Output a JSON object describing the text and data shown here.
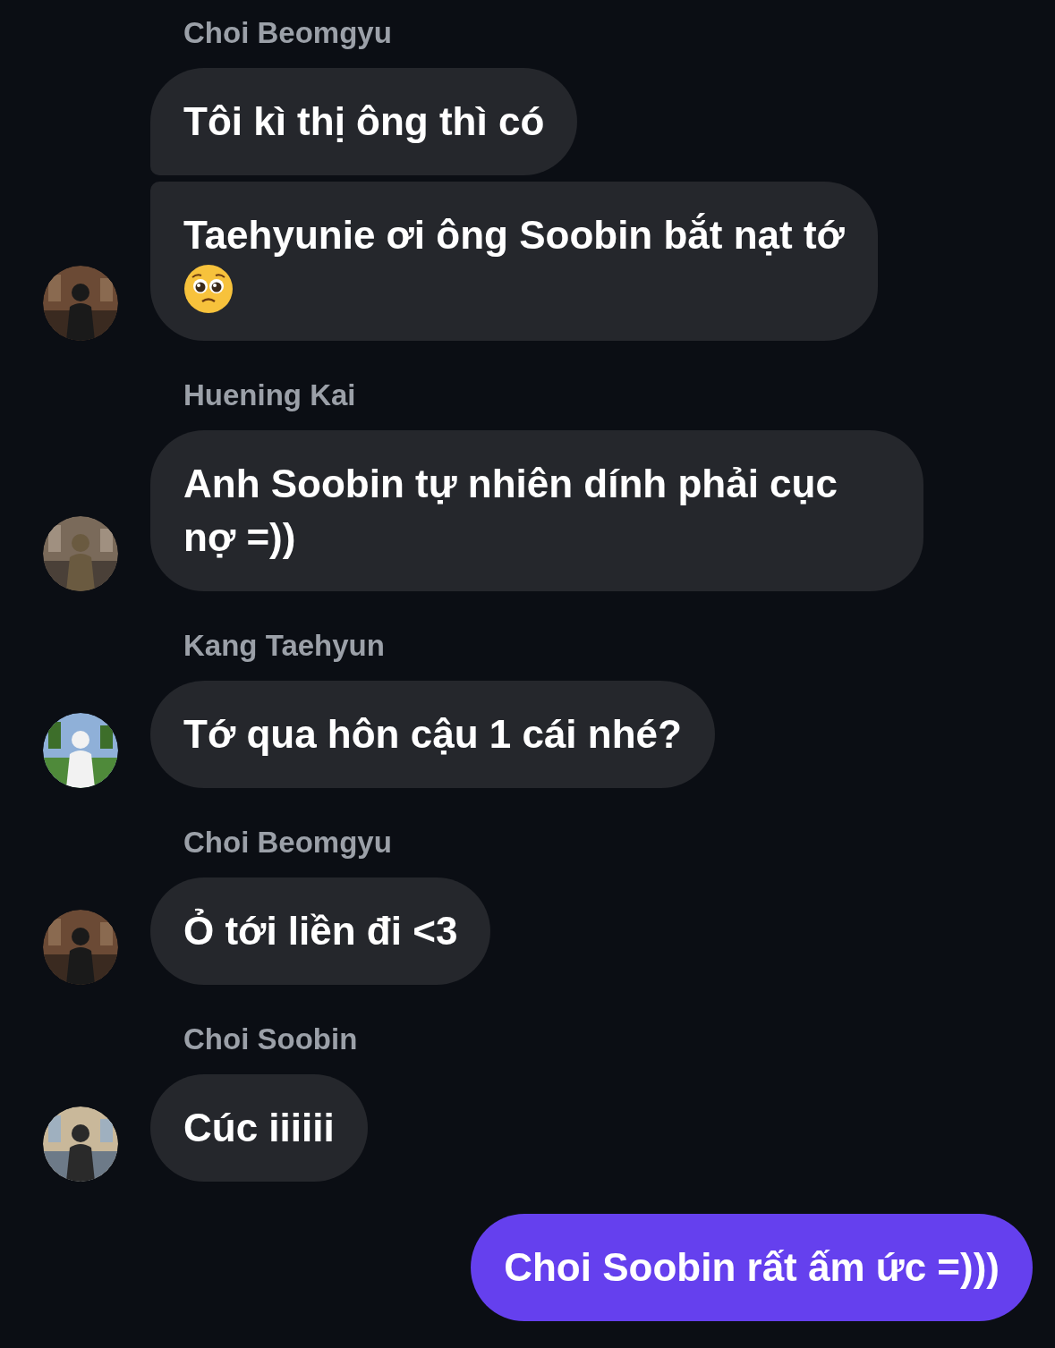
{
  "groups": [
    {
      "sender": "Choi Beomgyu",
      "avatar": {
        "kind": "picture"
      },
      "messages": [
        {
          "kind": "text",
          "text": "Tôi kì thị ông thì có"
        },
        {
          "kind": "text_with_emoji",
          "text": "Taehyunie ơi ông Soobin bắt nạt tớ"
        }
      ]
    },
    {
      "sender": "Huening Kai",
      "avatar": {
        "kind": "picture"
      },
      "messages": [
        {
          "text": "Anh Soobin tự nhiên dính phải cục nợ =))"
        }
      ]
    },
    {
      "sender": "Kang Taehyun",
      "avatar": {
        "kind": "picture"
      },
      "messages": [
        {
          "text": "Tớ qua hôn cậu 1 cái nhé?"
        }
      ]
    },
    {
      "sender": "Choi Beomgyu",
      "avatar": {
        "kind": "picture"
      },
      "messages": [
        {
          "text": "Ỏ tới liền đi <3"
        }
      ]
    },
    {
      "sender": "Choi Soobin",
      "avatar": {
        "kind": "picture"
      },
      "messages": [
        {
          "text": "Cúc iiiiii"
        }
      ]
    }
  ],
  "outgoing": [
    {
      "text": "Choi Soobin rất ấm ức =)))"
    }
  ]
}
